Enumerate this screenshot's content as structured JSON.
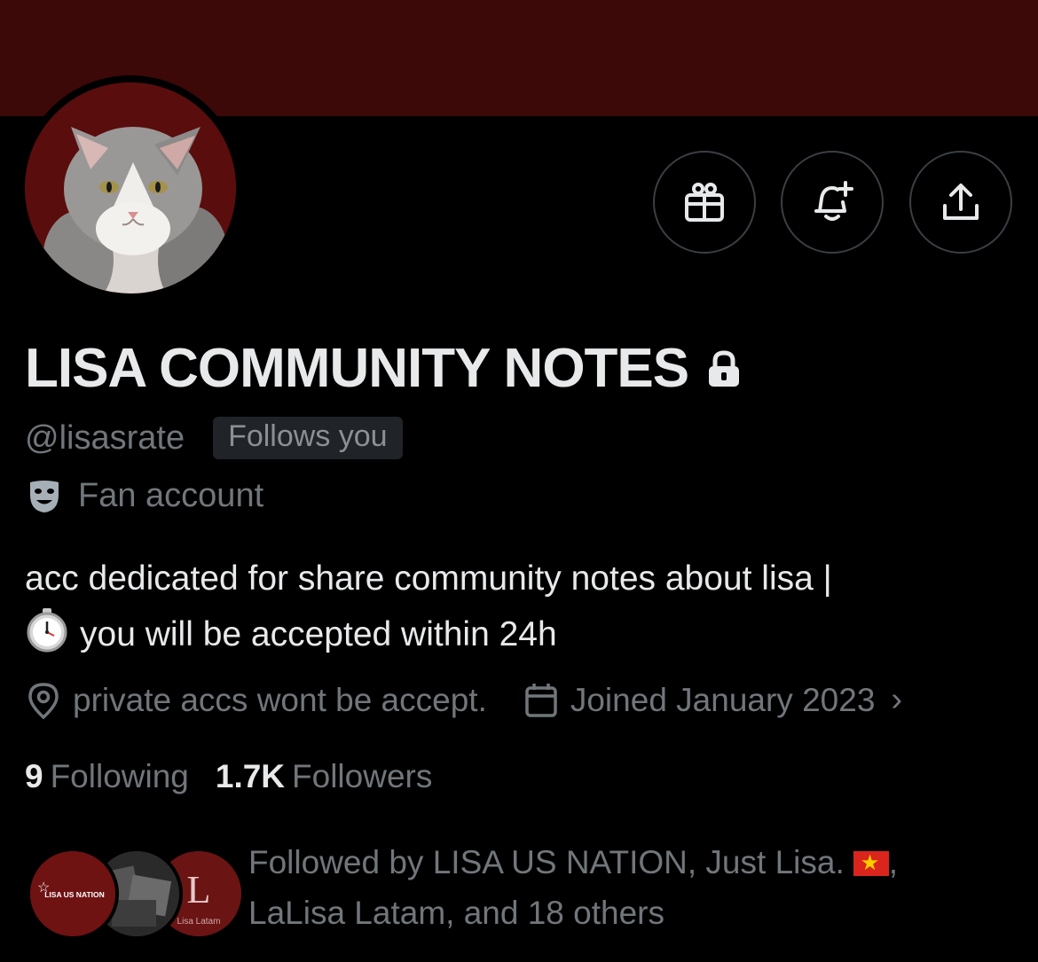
{
  "profile": {
    "display_name": "LISA COMMUNITY NOTES",
    "handle": "@lisasrate",
    "follows_you": "Follows you",
    "category": "Fan account",
    "bio_line1": "acc dedicated for share community notes about lisa |",
    "bio_line2": "you will be accepted within 24h",
    "location": "private accs wont be accept.",
    "joined": "Joined January 2023",
    "following_count": "9",
    "following_label": "Following",
    "followers_count": "1.7K",
    "followers_label": "Followers"
  },
  "followed_by": {
    "line1": "Followed by LISA US NATION, Just Lisa.",
    "comma": ",",
    "line2": "LaLisa Latam, and 18 others",
    "avatar_labels": [
      "LISA US NATION",
      "L",
      "Lisa Latam"
    ]
  },
  "icons": {
    "actions": [
      "gift-icon",
      "bell-plus-icon",
      "share-icon"
    ],
    "lock": "lock-icon",
    "category": "theater-mask-icon",
    "location": "location-pin-icon",
    "calendar": "calendar-icon",
    "stopwatch": "stopwatch-emoji",
    "flag": "vietnam-flag-emoji"
  },
  "colors": {
    "banner": "#3d0808",
    "background": "#000000",
    "primary_text": "#e7e9ea",
    "secondary_text": "#71767b",
    "badge_bg": "#202327"
  }
}
